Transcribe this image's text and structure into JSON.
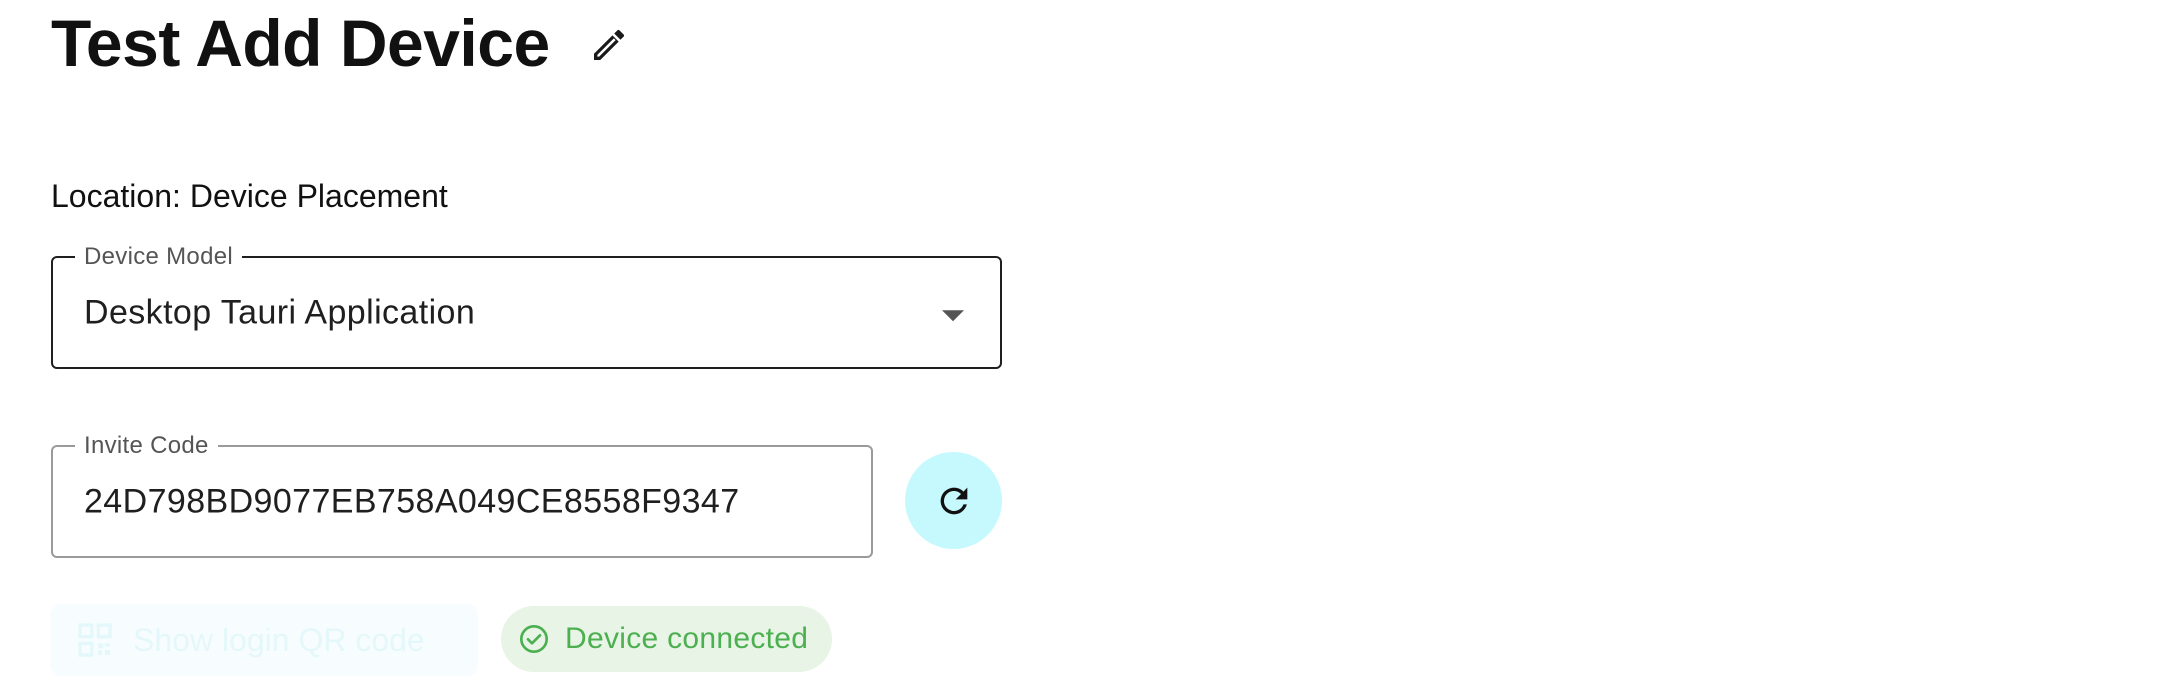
{
  "header": {
    "title": "Test Add Device",
    "edit_icon": "pencil-icon"
  },
  "location": {
    "label": "Location:",
    "value": "Device Placement"
  },
  "device_model": {
    "label": "Device Model",
    "value": "Desktop Tauri Application",
    "caret_icon": "caret-down-icon"
  },
  "invite_code": {
    "label": "Invite Code",
    "value": "24D798BD9077EB758A049CE8558F9347",
    "refresh_icon": "refresh-icon",
    "refresh_bg": "#c6f9fd"
  },
  "qr_button": {
    "label": "Show login QR code",
    "icon": "qr-code-icon",
    "disabled": true
  },
  "status": {
    "label": "Device connected",
    "icon": "check-circle-icon",
    "color": "#4caf50",
    "background": "#e8f4e6"
  }
}
